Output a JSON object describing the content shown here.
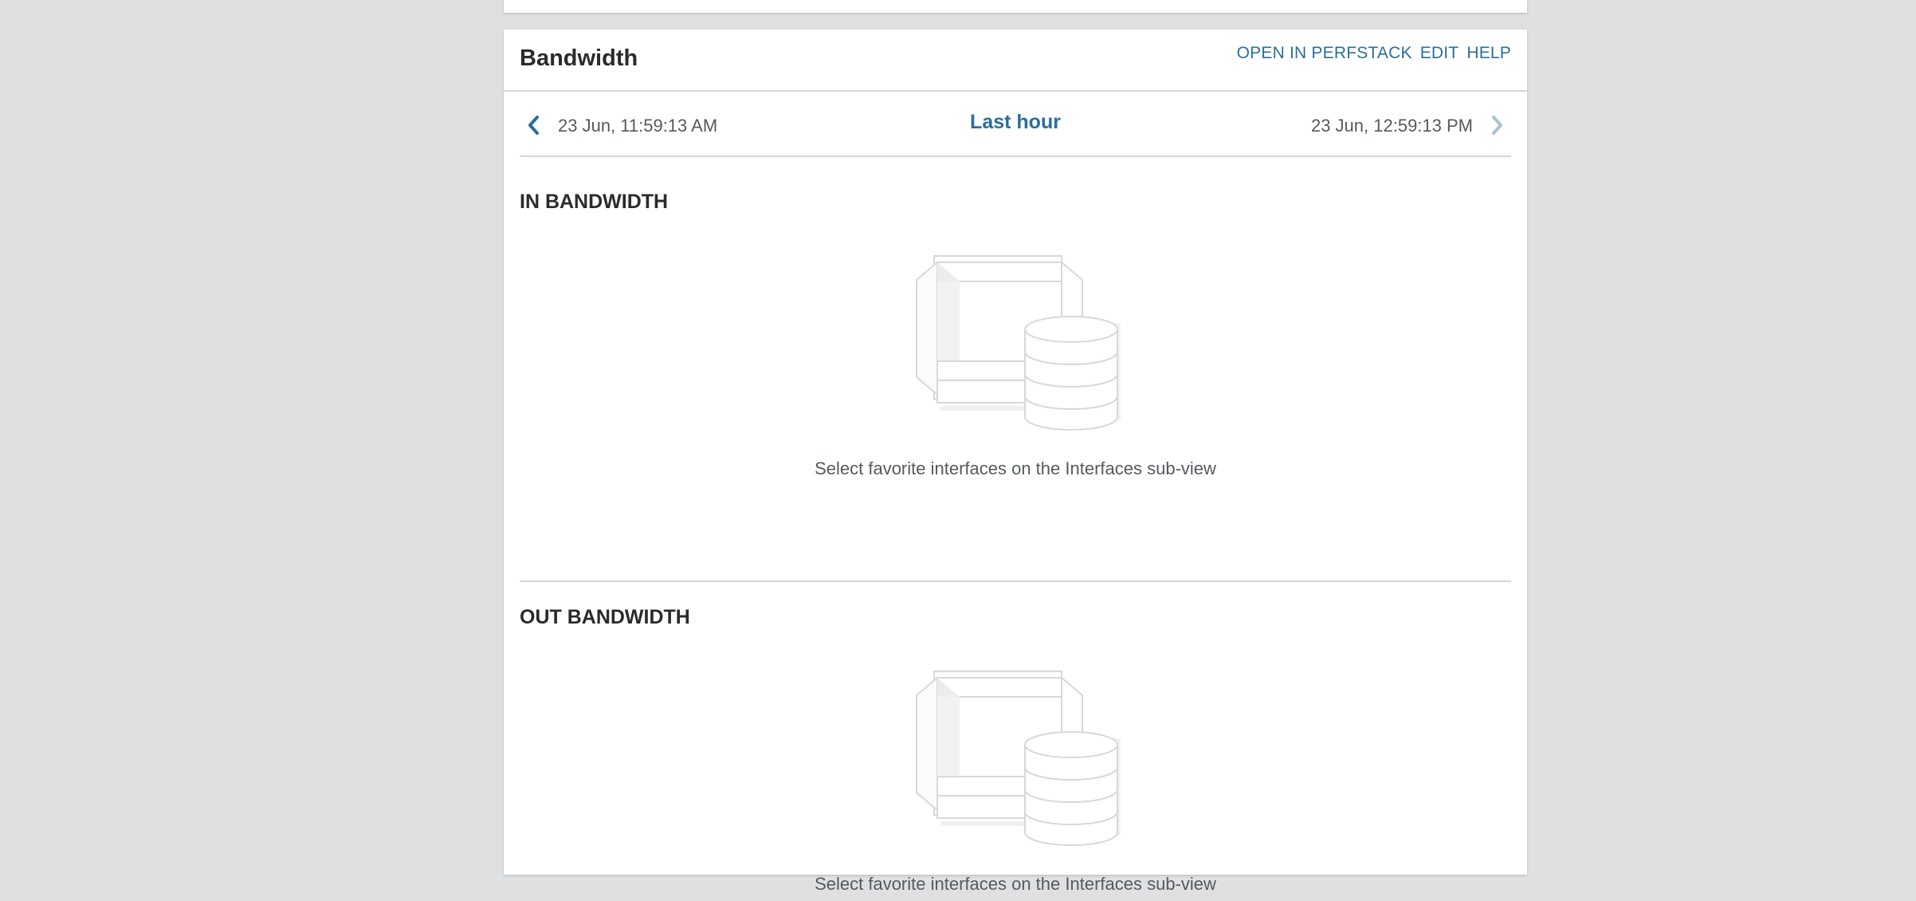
{
  "widget": {
    "title": "Bandwidth",
    "links": {
      "open_perfstack": "OPEN IN PERFSTACK",
      "edit": "EDIT",
      "help": "HELP"
    },
    "time": {
      "start": "23 Jun, 11:59:13 AM",
      "range": "Last hour",
      "end": "23 Jun, 12:59:13 PM"
    },
    "sections": {
      "in": {
        "title": "IN BANDWIDTH",
        "empty_message": "Select favorite interfaces on the Interfaces sub-view"
      },
      "out": {
        "title": "OUT BANDWIDTH",
        "empty_message": "Select favorite interfaces on the Interfaces sub-view"
      }
    }
  },
  "colors": {
    "background": "#dfe0e2",
    "link": "#2b6f9a",
    "title": "#2b2b2b",
    "muted_text": "#555a5e",
    "divider": "#d4d6d8",
    "next_disabled": "#a9c3d3"
  },
  "icons": {
    "prev": "chevron-left-icon",
    "next": "chevron-right-icon",
    "empty_state": "no-data-illustration"
  }
}
